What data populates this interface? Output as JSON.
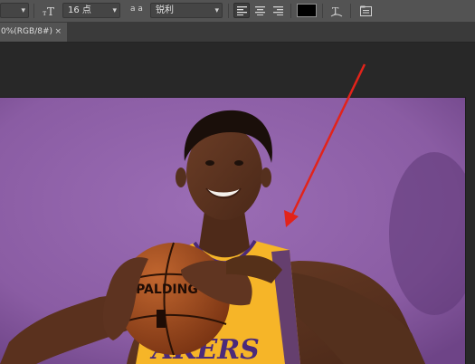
{
  "options_bar": {
    "font_style_value": "",
    "text_orientation_icon": "text-orientation-icon",
    "font_size_value": "16 点",
    "antialias_icon_label": "a a",
    "antialias_value": "锐利",
    "align_left_icon": "align-left-icon",
    "align_center_icon": "align-center-icon",
    "align_right_icon": "align-right-icon",
    "text_color": "#000000",
    "warp_text_icon": "warp-text-icon",
    "panels_icon": "character-panel-icon"
  },
  "document_tab": {
    "title": "0%(RGB/8#)",
    "close_glyph": "×"
  },
  "colors": {
    "background_purple": "#8a5ca3",
    "jersey_gold": "#f6b528",
    "annotation_arrow": "#e2231a"
  }
}
